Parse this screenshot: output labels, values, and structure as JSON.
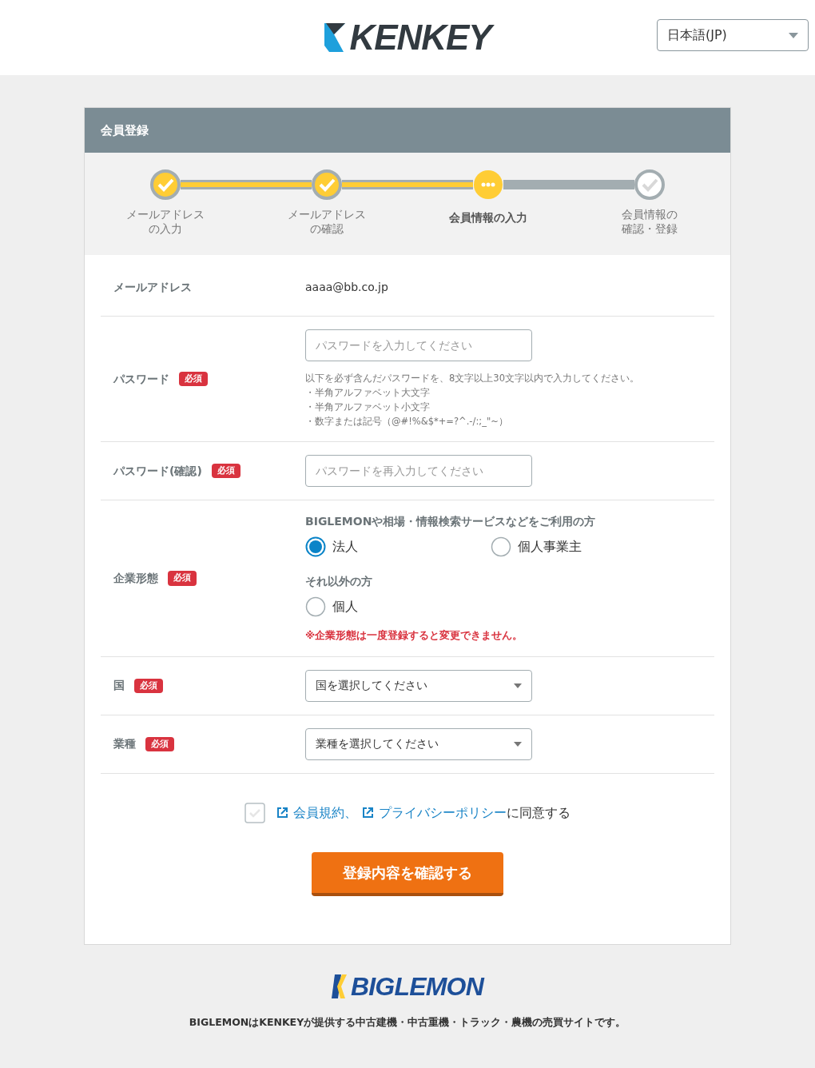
{
  "header": {
    "logo": "KENKEY",
    "language": "日本語(JP)"
  },
  "form": {
    "title": "会員登録",
    "steps": [
      {
        "label": [
          "メールアドレス",
          "の入力"
        ],
        "kind": "done"
      },
      {
        "label": [
          "メールアドレス",
          "の確認"
        ],
        "kind": "done"
      },
      {
        "label": [
          "会員情報の入力"
        ],
        "kind": "current"
      },
      {
        "label": [
          "会員情報の",
          "確認・登録"
        ],
        "kind": "todo"
      }
    ],
    "rows": [
      {
        "kind": "text",
        "label": "メールアドレス",
        "value": "aaaa@bb.co.jp"
      },
      {
        "kind": "password",
        "label": "パスワード",
        "badge": "必須",
        "placeholder": "パスワードを入力してください",
        "hint": [
          "以下を必ず含んだパスワードを、8文字以上30文字以内で入力してください。",
          "・半角アルファベット大文字",
          "・半角アルファベット小文字",
          "・数字または記号（@#!%&$*+=?^.-/:;_\"~）"
        ]
      },
      {
        "kind": "password",
        "label": "パスワード(確認)",
        "badge": "必須",
        "placeholder": "パスワードを再入力してください"
      },
      {
        "kind": "radio",
        "label": "企業形態",
        "badge": "必須",
        "groups": [
          {
            "heading": "BIGLEMONや相場・情報検索サービスなどをご利用の方",
            "options": [
              {
                "label": "法人",
                "selected": true
              },
              {
                "label": "個人事業主",
                "selected": false
              }
            ]
          },
          {
            "heading": "それ以外の方",
            "options": [
              {
                "label": "個人",
                "selected": false
              }
            ]
          }
        ],
        "note": "※企業形態は一度登録すると変更できません。"
      },
      {
        "kind": "select",
        "label": "国",
        "badge": "必須",
        "value": "国を選択してください"
      },
      {
        "kind": "select",
        "label": "業種",
        "badge": "必須",
        "value": "業種を選択してください"
      }
    ],
    "agreement": {
      "checked": false,
      "links": [
        "会員規約",
        "プライバシーポリシー"
      ],
      "separator": "、",
      "suffix": "に同意する"
    },
    "submit": "登録内容を確認する"
  },
  "footer": {
    "logo": "BIGLEMON",
    "description": "BIGLEMONはKENKEYが提供する中古建機・中古重機・トラック・農機の売買サイトです。"
  }
}
